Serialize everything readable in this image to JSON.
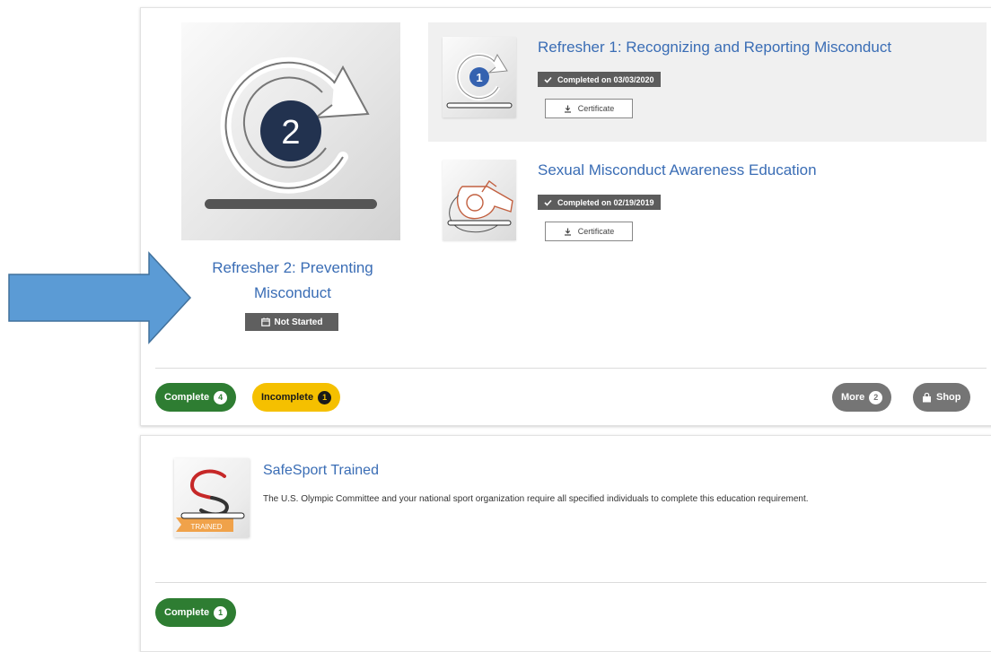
{
  "featured": {
    "title": "Refresher 2: Preventing Misconduct",
    "status": "Not Started",
    "badge_number": "2"
  },
  "courses": [
    {
      "title": "Refresher 1: Recognizing and Reporting Misconduct",
      "status": "Completed on 03/03/2020",
      "certificate_label": "Certificate",
      "badge_number": "1"
    },
    {
      "title": "Sexual Misconduct Awareness Education",
      "status": "Completed on 02/19/2019",
      "certificate_label": "Certificate"
    }
  ],
  "filters": {
    "complete": {
      "label": "Complete",
      "count": "4"
    },
    "incomplete": {
      "label": "Incomplete",
      "count": "1"
    },
    "more": {
      "label": "More",
      "count": "2"
    },
    "shop": {
      "label": "Shop"
    }
  },
  "safesport": {
    "title": "SafeSport Trained",
    "description": "The U.S. Olympic Committee and your national sport organization require all specified individuals to complete this education requirement.",
    "ribbon": "TRAINED",
    "complete": {
      "label": "Complete",
      "count": "1"
    }
  },
  "colors": {
    "link": "#3a6db5",
    "complete_green": "#2e7d32",
    "incomplete_yellow": "#f5c000",
    "neutral_gray": "#757575",
    "badge_navy": "#22324f",
    "arrow_blue": "#5b9bd5",
    "logo_red": "#c62828"
  }
}
